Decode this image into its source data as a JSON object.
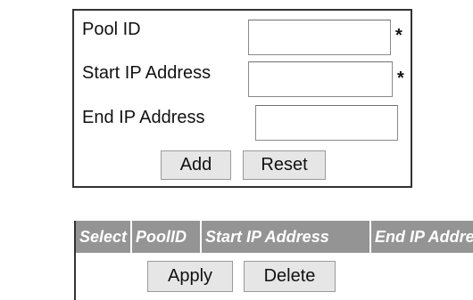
{
  "form": {
    "pool_id_label": "Pool ID",
    "start_ip_label": "Start IP Address",
    "end_ip_label": "End IP Address",
    "pool_id_value": "",
    "start_ip_value": "",
    "end_ip_value": "",
    "required_marker": "*",
    "add_label": "Add",
    "reset_label": "Reset"
  },
  "table": {
    "columns": [
      "Select",
      "PoolID",
      "Start IP Address",
      "End IP Address"
    ],
    "header_bg": "#949494",
    "apply_label": "Apply",
    "delete_label": "Delete"
  }
}
